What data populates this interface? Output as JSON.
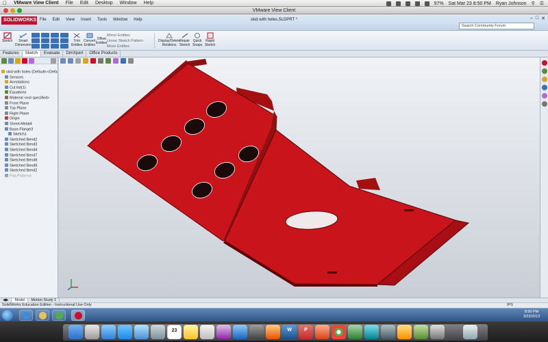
{
  "mac_menubar": {
    "app_name": "VMware View Client",
    "menus": [
      "File",
      "Edit",
      "Desktop",
      "Window",
      "Help"
    ],
    "battery": "97%",
    "datetime": "Sat Mar 23  8:50 PM",
    "user": "Ryan Johnson"
  },
  "window_title": "VMware View Client",
  "solidworks": {
    "logo": "SOLIDWORKS",
    "menus": [
      "File",
      "Edit",
      "View",
      "Insert",
      "Tools",
      "Window",
      "Help"
    ],
    "document_title": "skid with holes.SLDPRT *",
    "search_placeholder": "Search Community Forum",
    "commands": {
      "sketch": "Sketch",
      "smart_dimension": [
        "Smart",
        "Dimension"
      ],
      "trim": [
        "Trim",
        "Entities"
      ],
      "convert": [
        "Convert",
        "Entities"
      ],
      "offset": [
        "Offset",
        "Entities"
      ],
      "mirror": "Mirror Entities",
      "linear_pattern": "Linear Sketch Pattern",
      "move": "Move Entities",
      "display_delete": [
        "Display/Delete",
        "Relations"
      ],
      "repair": [
        "Repair",
        "Sketch"
      ],
      "quick_snaps": [
        "Quick",
        "Snaps"
      ],
      "rapid_sketch": [
        "Rapid",
        "Sketch"
      ]
    },
    "tabs": [
      "Features",
      "Sketch",
      "Evaluate",
      "DimXpert",
      "Office Products"
    ],
    "active_tab": "Sketch",
    "tree": [
      {
        "label": "skid with holes  (Default<<Default>",
        "level": 0,
        "color": "#d9a521"
      },
      {
        "label": "Sensors",
        "level": 1,
        "color": "#6b8bbf"
      },
      {
        "label": "Annotations",
        "level": 1,
        "color": "#d9a521"
      },
      {
        "label": "Cut list(1)",
        "level": 1,
        "color": "#6b8bbf"
      },
      {
        "label": "Equations",
        "level": 1,
        "color": "#5d8a3c"
      },
      {
        "label": "Material <not specified>",
        "level": 1,
        "color": "#8a6b4d"
      },
      {
        "label": "Front Plane",
        "level": 1,
        "color": "#7c8a9a"
      },
      {
        "label": "Top Plane",
        "level": 1,
        "color": "#7c8a9a"
      },
      {
        "label": "Right Plane",
        "level": 1,
        "color": "#7c8a9a"
      },
      {
        "label": "Origin",
        "level": 1,
        "color": "#b34545"
      },
      {
        "label": "Sheet-Metal4",
        "level": 1,
        "color": "#6b8bbf"
      },
      {
        "label": "Base-Flange3",
        "level": 1,
        "color": "#6b8bbf"
      },
      {
        "label": "Sketch1",
        "level": 2,
        "color": "#6b8bbf"
      },
      {
        "label": "Sketched Bend2",
        "level": 1,
        "color": "#6b8bbf"
      },
      {
        "label": "Sketched Bend3",
        "level": 1,
        "color": "#6b8bbf"
      },
      {
        "label": "Sketched Bend4",
        "level": 1,
        "color": "#6b8bbf"
      },
      {
        "label": "Sketched Bend7",
        "level": 1,
        "color": "#6b8bbf"
      },
      {
        "label": "Sketched Bend8",
        "level": 1,
        "color": "#6b8bbf"
      },
      {
        "label": "Sketched Bend9",
        "level": 1,
        "color": "#6b8bbf"
      },
      {
        "label": "Sketched Bend2",
        "level": 1,
        "color": "#6b8bbf"
      },
      {
        "label": "Flat-Pattern4",
        "level": 1,
        "color": "#9aa3ad",
        "dim": true
      }
    ],
    "bottom_tabs": [
      "Model",
      "Motion Study 1"
    ],
    "active_bottom_tab": "Model",
    "status_text": "SolidWorks Education Edition - Instructional Use Only",
    "units": "IPS",
    "part_color": "#c8141a"
  },
  "windows_taskbar": {
    "time": "8:50 PM",
    "date": "3/23/2013"
  },
  "dock": {
    "calendar_day": "23",
    "word_letter": "W",
    "powerpoint_letter": "P"
  }
}
